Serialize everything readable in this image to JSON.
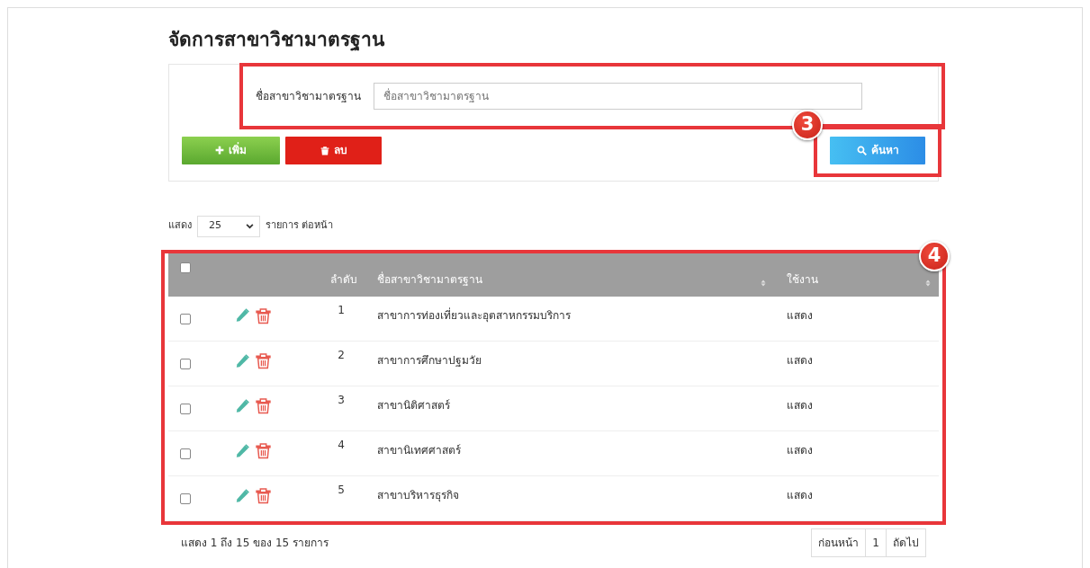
{
  "page": {
    "title": "จัดการสาขาวิชามาตรฐาน"
  },
  "search_panel": {
    "field_label": "ชื่อสาขาวิชามาตรฐาน",
    "placeholder": "ชื่อสาขาวิชามาตรฐาน"
  },
  "buttons": [
    {
      "kind": "add",
      "label": "เพิ่ม"
    },
    {
      "kind": "delete",
      "label": "ลบ"
    },
    {
      "kind": "search",
      "label": "ค้นหา"
    }
  ],
  "page_length": {
    "label_before": "แสดง",
    "value": "25",
    "label_after": "รายการ ต่อหน้า"
  },
  "table": {
    "select_all_checked": false,
    "columns": [
      {
        "label": "ลำดับ",
        "sortable": false
      },
      {
        "label": "ชื่อสาขาวิชามาตรฐาน",
        "sortable": true
      },
      {
        "label": "ใช้งาน",
        "sortable": true
      }
    ],
    "rows": [
      {
        "checked": false,
        "index": "1",
        "name": "สาขาการท่องเที่ยวและอุตสาหกรรมบริการ",
        "status": "แสดง"
      },
      {
        "checked": false,
        "index": "2",
        "name": "สาขาการศึกษาปฐมวัย",
        "status": "แสดง"
      },
      {
        "checked": false,
        "index": "3",
        "name": "สาขานิติศาสตร์",
        "status": "แสดง"
      },
      {
        "checked": false,
        "index": "4",
        "name": "สาขานิเทศศาสตร์",
        "status": "แสดง"
      },
      {
        "checked": false,
        "index": "5",
        "name": "สาขาบริหารธุรกิจ",
        "status": "แสดง"
      }
    ]
  },
  "footer": {
    "info": "แสดง 1 ถึง 15 ของ 15 รายการ",
    "pagination": [
      "ก่อนหน้า",
      "1",
      "ถัดไป"
    ]
  },
  "annotations": [
    {
      "kind": "field"
    },
    {
      "kind": "search",
      "label": "3"
    },
    {
      "kind": "table",
      "label": "4"
    }
  ]
}
